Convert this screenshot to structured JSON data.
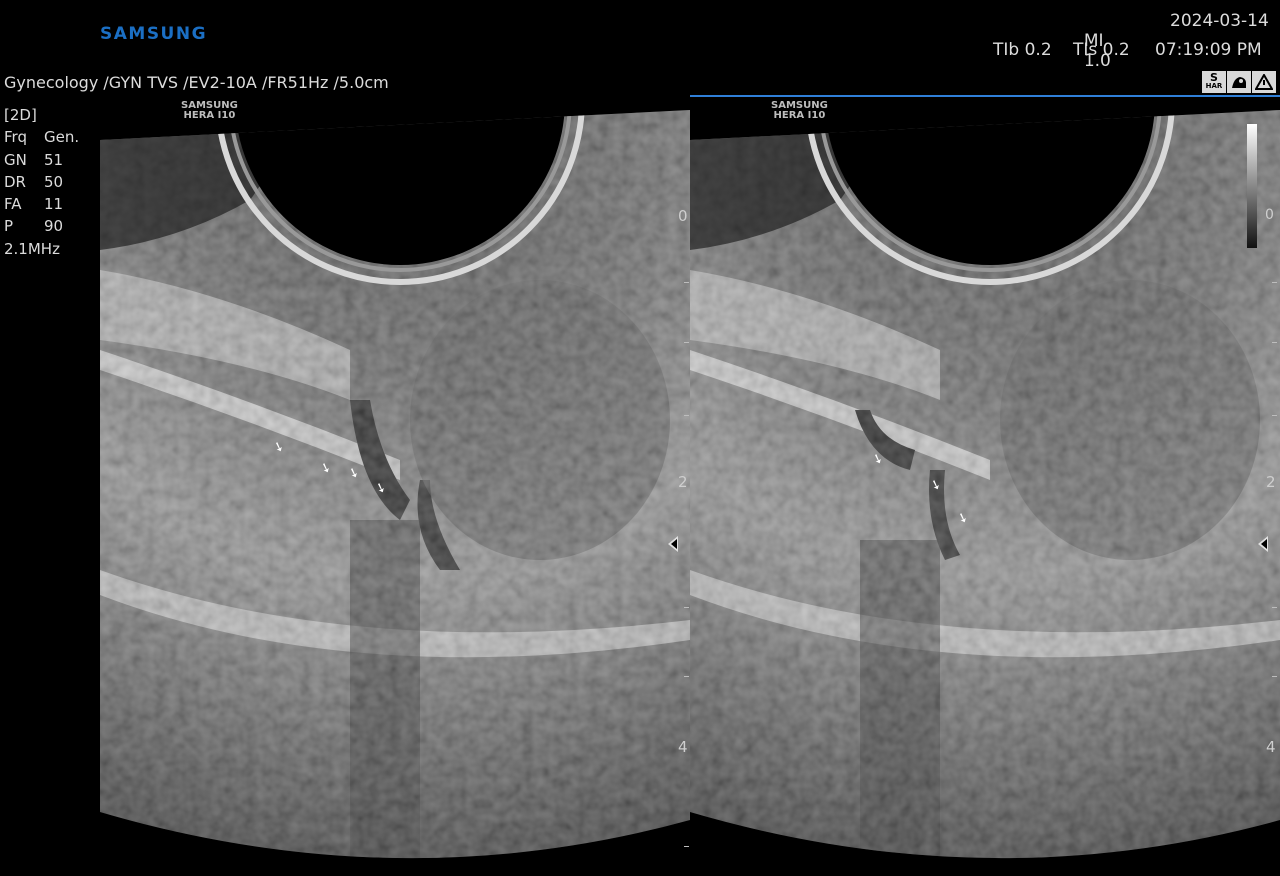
{
  "brand": "SAMSUNG",
  "header": {
    "mi_label": "MI",
    "mi_value": "1.0",
    "date": "2024-03-14",
    "tib": "TIb 0.2",
    "tis": "TIs 0.2",
    "time": "07:19:09 PM"
  },
  "exam_line": "Gynecology /GYN TVS /EV2-10A /FR51Hz /5.0cm",
  "mode": "[2D]",
  "params": [
    {
      "k": "Frq",
      "v": "Gen."
    },
    {
      "k": "GN",
      "v": "51"
    },
    {
      "k": "DR",
      "v": "50"
    },
    {
      "k": "FA",
      "v": "11"
    },
    {
      "k": "P",
      "v": "90"
    },
    {
      "k": "",
      "v": "2.1MHz"
    }
  ],
  "icons": {
    "s_har_top": "S",
    "s_har_bottom": "HAR"
  },
  "probe_label_top": "SAMSUNG",
  "probe_label_bottom": "HERA I10",
  "depth_marks": [
    "0",
    "2",
    "4"
  ],
  "grayscale_label": "0",
  "arrow_glyph": "➘"
}
